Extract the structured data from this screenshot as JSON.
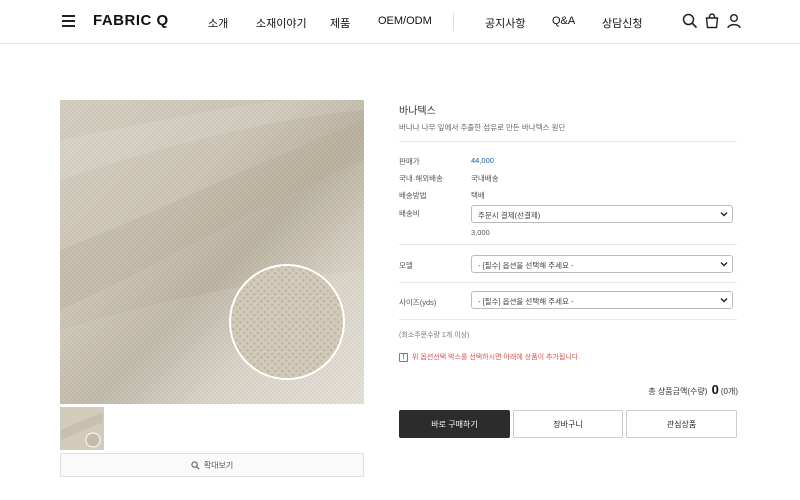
{
  "header": {
    "logo": "FABRIC Q",
    "nav": [
      "소개",
      "소재이야기",
      "제품",
      "OEM/ODM",
      "공지사항",
      "Q&A",
      "상담신청"
    ]
  },
  "product": {
    "title": "바나텍스",
    "subtitle": "바나나 나무 잎에서 추출한 섬유로 만든 바나텍스 원단",
    "price_label": "판매가",
    "price": "44,000",
    "shipping_region_label": "국내·해외배송",
    "shipping_region": "국내배송",
    "shipping_method_label": "배송방법",
    "shipping_method": "택배",
    "shipping_fee_label": "배송비",
    "shipping_fee_select": "주문시 결제(선결제)",
    "shipping_fee_amount": "3,000",
    "model_label": "모델",
    "model_select": "- [필수] 옵션을 선택해 주세요 -",
    "size_label": "사이즈(yds)",
    "size_select": "- [필수] 옵션을 선택해 주세요 -",
    "min_qty": "(최소주문수량 1개 이상)",
    "notice": "위 옵션선택 박스를 선택하시면 아래에 상품이 추가됩니다.",
    "total_label": "총 상품금액(수량)",
    "total_value": "0",
    "total_count": "(0개)"
  },
  "buttons": {
    "buy": "바로 구매하기",
    "cart": "장바구니",
    "wish": "관심상품",
    "zoom": "확대보기"
  },
  "colors": {
    "accent_price": "#1a5fa0",
    "buy_button": "#2c2c2c",
    "notice": "#d9534f",
    "fabric": "#d8d2c4"
  }
}
